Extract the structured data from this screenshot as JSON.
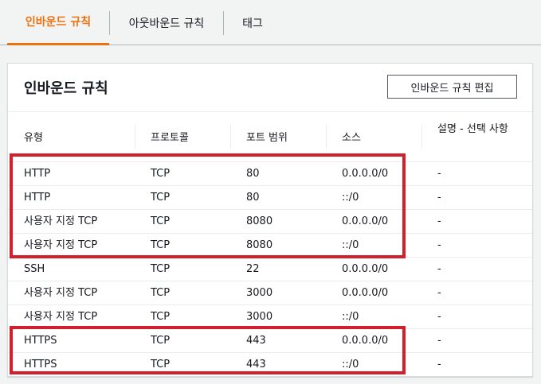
{
  "tabs": [
    {
      "label": "인바운드 규칙",
      "active": true
    },
    {
      "label": "아웃바운드 규칙",
      "active": false
    },
    {
      "label": "태그",
      "active": false
    }
  ],
  "panel": {
    "title": "인바운드 규칙",
    "edit_button": "인바운드 규칙 편집"
  },
  "table": {
    "columns": [
      "유형",
      "프로토콜",
      "포트 범위",
      "소스",
      "설명 - 선택 사항"
    ],
    "rows": [
      {
        "type": "HTTP",
        "protocol": "TCP",
        "port": "80",
        "source": "0.0.0.0/0",
        "description": "-"
      },
      {
        "type": "HTTP",
        "protocol": "TCP",
        "port": "80",
        "source": "::/0",
        "description": "-"
      },
      {
        "type": "사용자 지정 TCP",
        "protocol": "TCP",
        "port": "8080",
        "source": "0.0.0.0/0",
        "description": "-"
      },
      {
        "type": "사용자 지정 TCP",
        "protocol": "TCP",
        "port": "8080",
        "source": "::/0",
        "description": "-"
      },
      {
        "type": "SSH",
        "protocol": "TCP",
        "port": "22",
        "source": "0.0.0.0/0",
        "description": "-"
      },
      {
        "type": "사용자 지정 TCP",
        "protocol": "TCP",
        "port": "3000",
        "source": "0.0.0.0/0",
        "description": "-"
      },
      {
        "type": "사용자 지정 TCP",
        "protocol": "TCP",
        "port": "3000",
        "source": "::/0",
        "description": "-"
      },
      {
        "type": "HTTPS",
        "protocol": "TCP",
        "port": "443",
        "source": "0.0.0.0/0",
        "description": "-"
      },
      {
        "type": "HTTPS",
        "protocol": "TCP",
        "port": "443",
        "source": "::/0",
        "description": "-"
      }
    ]
  },
  "colors": {
    "accent": "#ec7211",
    "highlight": "#d0202d"
  }
}
